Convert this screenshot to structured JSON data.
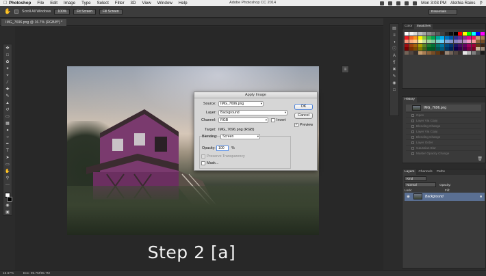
{
  "menubar": {
    "app_name": "Photoshop",
    "items": [
      "File",
      "Edit",
      "Image",
      "Type",
      "Select",
      "Filter",
      "3D",
      "View",
      "Window",
      "Help"
    ],
    "window_title": "Adobe Photoshop CC 2014",
    "clock": "Mon 3:03 PM",
    "user": "Alethia Rains"
  },
  "options_bar": {
    "scroll_all_label": "Scroll All Windows",
    "zoom_100": "100%",
    "fit_screen": "Fit Screen",
    "fill_screen": "Fill Screen",
    "workspace": "Essentials"
  },
  "document": {
    "tab_label": "IMG_7696.png @ 16.7% (RGB/8*) *"
  },
  "apply_image": {
    "title": "Apply Image",
    "source_label": "Source:",
    "source_value": "IMG_7696.png",
    "layer_label": "Layer:",
    "layer_value": "Background",
    "channel_label": "Channel:",
    "channel_value": "RGB",
    "invert_label": "Invert",
    "target_label": "Target:",
    "target_value": "IMG_7696.png (RGB)",
    "blending_label": "Blending:",
    "blending_value": "Screen",
    "opacity_label": "Opacity:",
    "opacity_value": "100",
    "opacity_unit": "%",
    "preserve_label": "Preserve Transparency",
    "mask_label": "Mask...",
    "ok_label": "OK",
    "cancel_label": "Cancel",
    "preview_label": "Preview",
    "preview_checked": true
  },
  "caption": "Step 2 [a]",
  "panels": {
    "swatches_tabs": [
      "Color",
      "Swatches"
    ],
    "history_tab": "History",
    "history_snapshot": "IMG_7696.png",
    "history_items": [
      "Open",
      "Layer Via Copy",
      "Blending Change",
      "Layer Via Copy",
      "Blending Change",
      "Layer Order",
      "Gaussian Blur",
      "Master Opacity Change"
    ],
    "layers_tabs": [
      "Layers",
      "Channels",
      "Paths"
    ],
    "layers_kind": "Kind",
    "blend_mode": "Normal",
    "opacity_label": "Opacity:",
    "lock_label": "Lock:",
    "fill_label": "Fill:",
    "layer_name": "Background"
  },
  "status": {
    "zoom": "16.67%",
    "doc_size": "Doc: 95.7M/95.7M"
  },
  "swatch_colors": [
    "#ffffff",
    "#f2f2f2",
    "#d9d9d9",
    "#bfbfbf",
    "#a6a6a6",
    "#8c8c8c",
    "#737373",
    "#595959",
    "#404040",
    "#262626",
    "#0d0d0d",
    "#000000",
    "#ff0000",
    "#ffff00",
    "#00ff00",
    "#00ffff",
    "#0000ff",
    "#ff00ff",
    "#ed1c24",
    "#f26522",
    "#f7941d",
    "#fff200",
    "#8dc63f",
    "#39b54a",
    "#00a651",
    "#00a99d",
    "#00aeef",
    "#0072bc",
    "#0054a6",
    "#2e3192",
    "#662d91",
    "#92278f",
    "#ec008c",
    "#ed145b",
    "#c69c6d",
    "#a67c52",
    "#f7977a",
    "#f9ad81",
    "#fdc68a",
    "#fff79a",
    "#c4df9b",
    "#a3d39c",
    "#82ca9d",
    "#7bcdc8",
    "#6ecff6",
    "#7ea7d8",
    "#8493ca",
    "#8882be",
    "#a186be",
    "#bc8dbf",
    "#f49ac2",
    "#f6989d",
    "#8c6239",
    "#754c24",
    "#9e0b0f",
    "#a0410d",
    "#a36209",
    "#aba000",
    "#598527",
    "#1a7b30",
    "#007236",
    "#00746b",
    "#0076a3",
    "#004a80",
    "#003471",
    "#1b1464",
    "#440e62",
    "#630460",
    "#9e005d",
    "#9e0039",
    "#603913",
    "#3c2415",
    "#790000",
    "#7b2e00",
    "#7d4900",
    "#827b00",
    "#406618",
    "#005e20",
    "#005826",
    "#005952",
    "#005b7f",
    "#003663",
    "#002157",
    "#0d004c",
    "#32004b",
    "#4b0049",
    "#7b0046",
    "#7a0026",
    "#c7b299",
    "#998675",
    "#736357",
    "#534741",
    "#37302d",
    "#c69c6d",
    "#a67c52",
    "#8c6239",
    "#754c24",
    "#603913",
    "#3c2415",
    "#998675",
    "#736357",
    "#534741",
    "#37302d",
    "#e6e6e6",
    "#b3b3b3",
    "#808080",
    "#4d4d4d",
    "#1a1a1a"
  ]
}
